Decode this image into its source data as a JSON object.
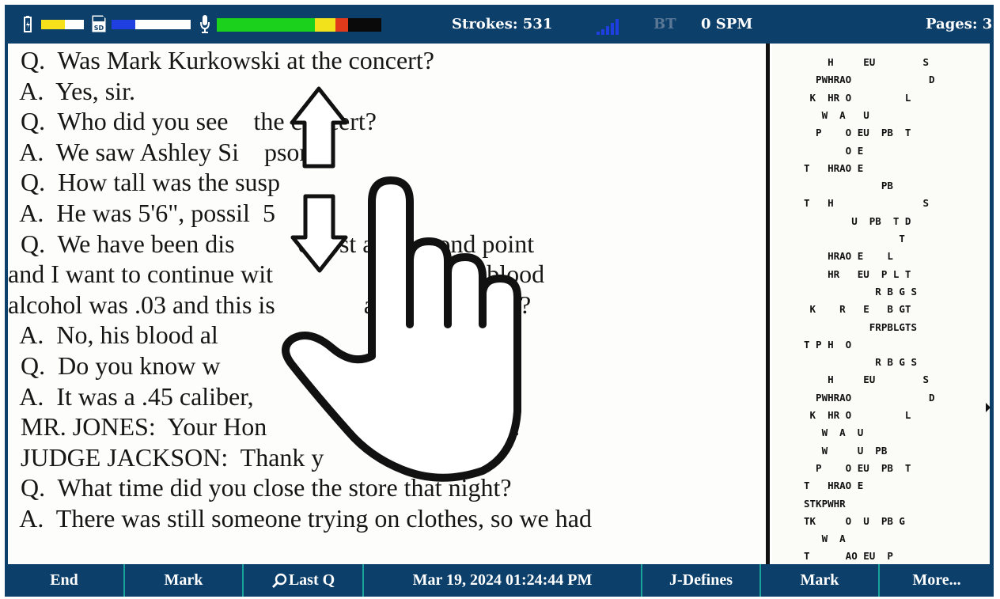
{
  "status_bar": {
    "battery_icon": "battery-icon",
    "sd_icon": "sd-card-icon",
    "mic_icon": "microphone-icon",
    "signal_icon": "signal-bars-icon",
    "battery_level": 0.55,
    "sd_level": 0.3,
    "mic_level": 0.8,
    "strokes_label": "Strokes: 531",
    "bt_label": "BT",
    "spm_label": "0 SPM",
    "pages_label": "Pages: 3",
    "colors": {
      "bar_bg": "#0d3f6b",
      "battery": "#f5e21a",
      "sd": "#1f3fe0",
      "mic_green": "#1bd11b",
      "mic_yellow": "#f2e21b",
      "mic_red": "#e03a1a"
    }
  },
  "transcript": {
    "lines": [
      "  Q.  Was Mark Kurkowski at the concert?",
      "  A.  Yes, sir.",
      "  Q.  Who did you see    the concert?",
      "  A.  We saw Ashley Si    pson.",
      "  Q.  How tall was the susp",
      "  A.  He was 5'6\", possil  5",
      "  Q.  We have been dis          e first and second point",
      "and I want to continue wit                point.  His blood",
      "alcohol was .03 and this is              al limit; correct?",
      "  A.  No, his blood al",
      "  Q.  Do you know w                    was?",
      "  A.  It was a .45 caliber,              it.",
      "  MR. JONES:  Your Hon                ng to Article 6.",
      "  JUDGE JACKSON:  Thank y",
      "  Q.  What time did you close the store that night?",
      "  A.  There was still someone trying on clothes, so we had"
    ]
  },
  "steno": {
    "lines": [
      "    H     EU        S",
      "  PWHRAO             D",
      " K  HR O         L",
      "   W  A   U",
      "  P    O EU  PB  T",
      "       O E",
      "T   HRAO E",
      "             PB",
      "T   H               S",
      "        U  PB  T D",
      "                T",
      "    HRAO E    L",
      "    HR   EU  P L T",
      "            R B G S",
      " K    R   E   B GT",
      "           FRPBLGTS",
      "T P H  O",
      "            R B G S",
      "    H     EU        S",
      "  PWHRAO             D",
      " K  HR O         L",
      "   W  A  U",
      "   W     U  PB",
      "  P    O EU  PB  T",
      "T   HRAO E",
      "STKPWHR",
      "TK     O  U  PB G",
      "   W  A",
      "T      AO EU  P"
    ]
  },
  "gestures": {
    "up_arrow_icon": "up-arrow-icon",
    "down_arrow_icon": "down-arrow-icon",
    "hand_icon": "pointing-hand-icon"
  },
  "bottom_bar": {
    "end": "End",
    "mark1": "Mark",
    "last_q": "Last Q",
    "last_q_icon": "search-icon",
    "datetime": "Mar 19, 2024  01:24:44 PM",
    "j_defines": "J-Defines",
    "mark2": "Mark",
    "more": "More..."
  }
}
